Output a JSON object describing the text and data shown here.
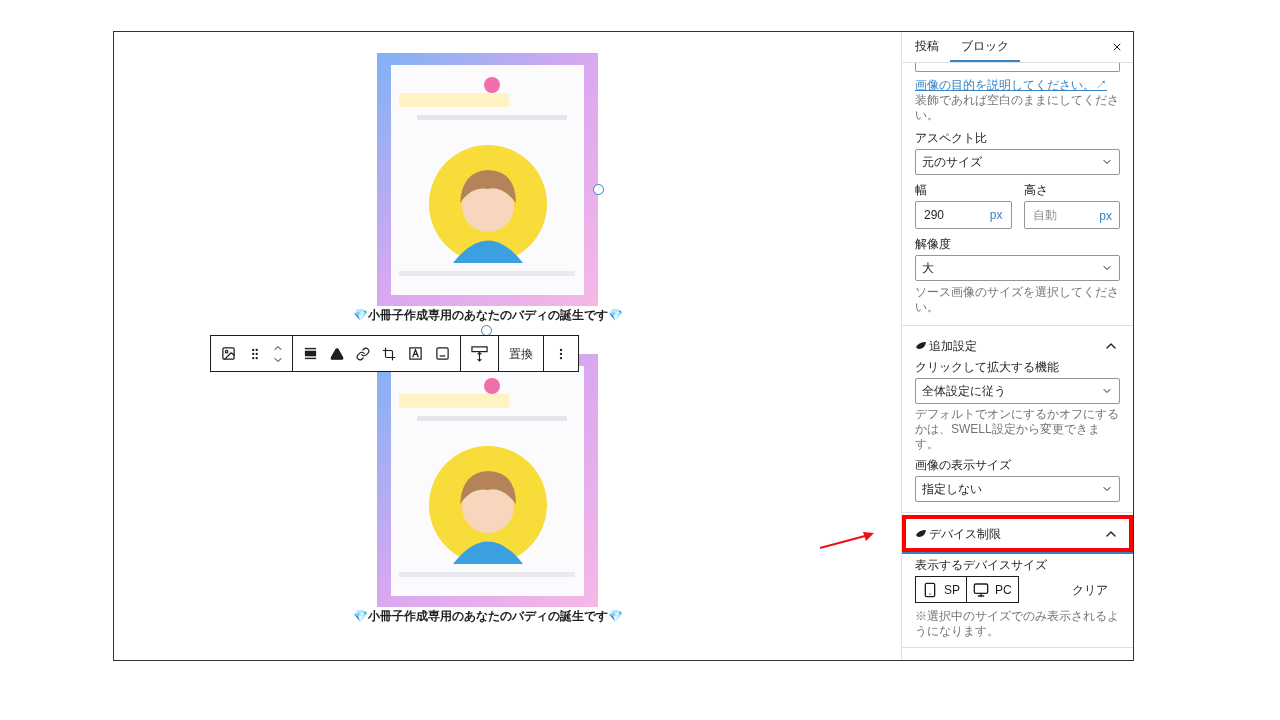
{
  "canvas": {
    "images": [
      {
        "kind": "picture",
        "caption": "💎小冊子作成専用のあなたのバディの誕生です💎",
        "selected": true
      },
      {
        "kind": "picture",
        "caption": "💎小冊子作成専用のあなたのバディの誕生です💎",
        "selected": false
      }
    ],
    "toolbar": {
      "replace_label": "置換"
    }
  },
  "sidebar": {
    "tabs": [
      {
        "label": "投稿",
        "selected": false
      },
      {
        "label": "ブロック",
        "selected": true
      }
    ],
    "alt_link": "画像の目的を説明してください。↗",
    "alt_help": "装飾であれば空白のままにしてください。",
    "aspect": {
      "label": "アスペクト比",
      "value": "元のサイズ"
    },
    "width": {
      "label": "幅",
      "value": "290",
      "unit": "px"
    },
    "height": {
      "label": "高さ",
      "placeholder": "自動",
      "unit": "px"
    },
    "resolution": {
      "label": "解像度",
      "value": "大",
      "help": "ソース画像のサイズを選択してください。"
    },
    "sections": [
      {
        "kind": "extra",
        "title": "追加設定",
        "expanded": true,
        "highlighted": false,
        "zoom_label": "クリックして拡大する機能",
        "zoom_value": "全体設定に従う",
        "zoom_help": "デフォルトでオンにするかオフにするかは、SWELL設定から変更できます。",
        "size_label": "画像の表示サイズ",
        "size_value": "指定しない"
      },
      {
        "kind": "device",
        "title": "デバイス制限",
        "expanded": true,
        "highlighted": true,
        "label": "表示するデバイスサイズ",
        "devices": [
          {
            "label": "SP",
            "selected": false
          },
          {
            "label": "PC",
            "selected": false
          }
        ],
        "clear": "クリア",
        "note": "※選択中のサイズでのみ表示されるようになります。"
      }
    ]
  },
  "annotation": {
    "arrow": true
  }
}
